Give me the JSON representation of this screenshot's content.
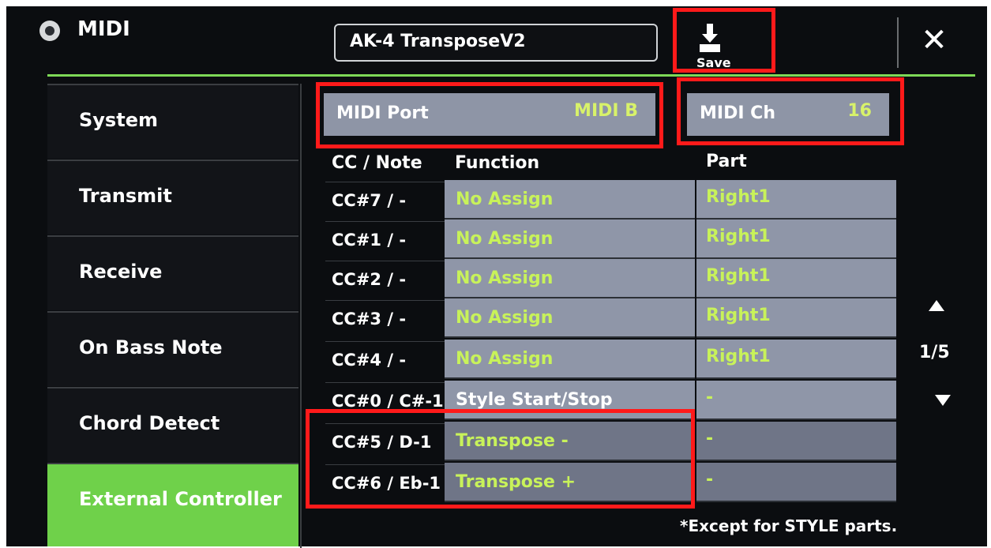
{
  "header": {
    "title": "MIDI",
    "file_name": "AK-4 TransposeV2",
    "save_label": "Save",
    "close_symbol": "✕",
    "icon": "midi-connector-icon"
  },
  "sidebar": {
    "items": [
      {
        "label": "System"
      },
      {
        "label": "Transmit"
      },
      {
        "label": "Receive"
      },
      {
        "label": "On Bass Note"
      },
      {
        "label": "Chord Detect"
      },
      {
        "label": "External Controller",
        "active": true
      }
    ]
  },
  "settings": {
    "midi_port_label": "MIDI Port",
    "midi_port_value": "MIDI B",
    "midi_ch_label": "MIDI Ch",
    "midi_ch_value": "16"
  },
  "table": {
    "headers": {
      "cc": "CC / Note",
      "function": "Function",
      "part": "Part"
    },
    "rows": [
      {
        "cc": "CC#7 / -",
        "function": "No Assign",
        "part": "Right1"
      },
      {
        "cc": "CC#1 / -",
        "function": "No Assign",
        "part": "Right1"
      },
      {
        "cc": "CC#2 / -",
        "function": "No Assign",
        "part": "Right1"
      },
      {
        "cc": "CC#3 / -",
        "function": "No Assign",
        "part": "Right1"
      },
      {
        "cc": "CC#4 / -",
        "function": "No Assign",
        "part": "Right1"
      },
      {
        "cc": "CC#0 / C#-1",
        "function": "Style Start/Stop",
        "part": "-"
      },
      {
        "cc": "CC#5 / D-1",
        "function": "Transpose -",
        "part": "-"
      },
      {
        "cc": "CC#6 / Eb-1",
        "function": "Transpose +",
        "part": "-"
      }
    ]
  },
  "pagination": {
    "page": "1/5"
  },
  "footnote": "*Except for STYLE parts.",
  "colors": {
    "accent": "#7ed957",
    "highlight": "#ff1a1a",
    "value_text": "#c8f25a",
    "cell_bg": "#8f96a8"
  }
}
